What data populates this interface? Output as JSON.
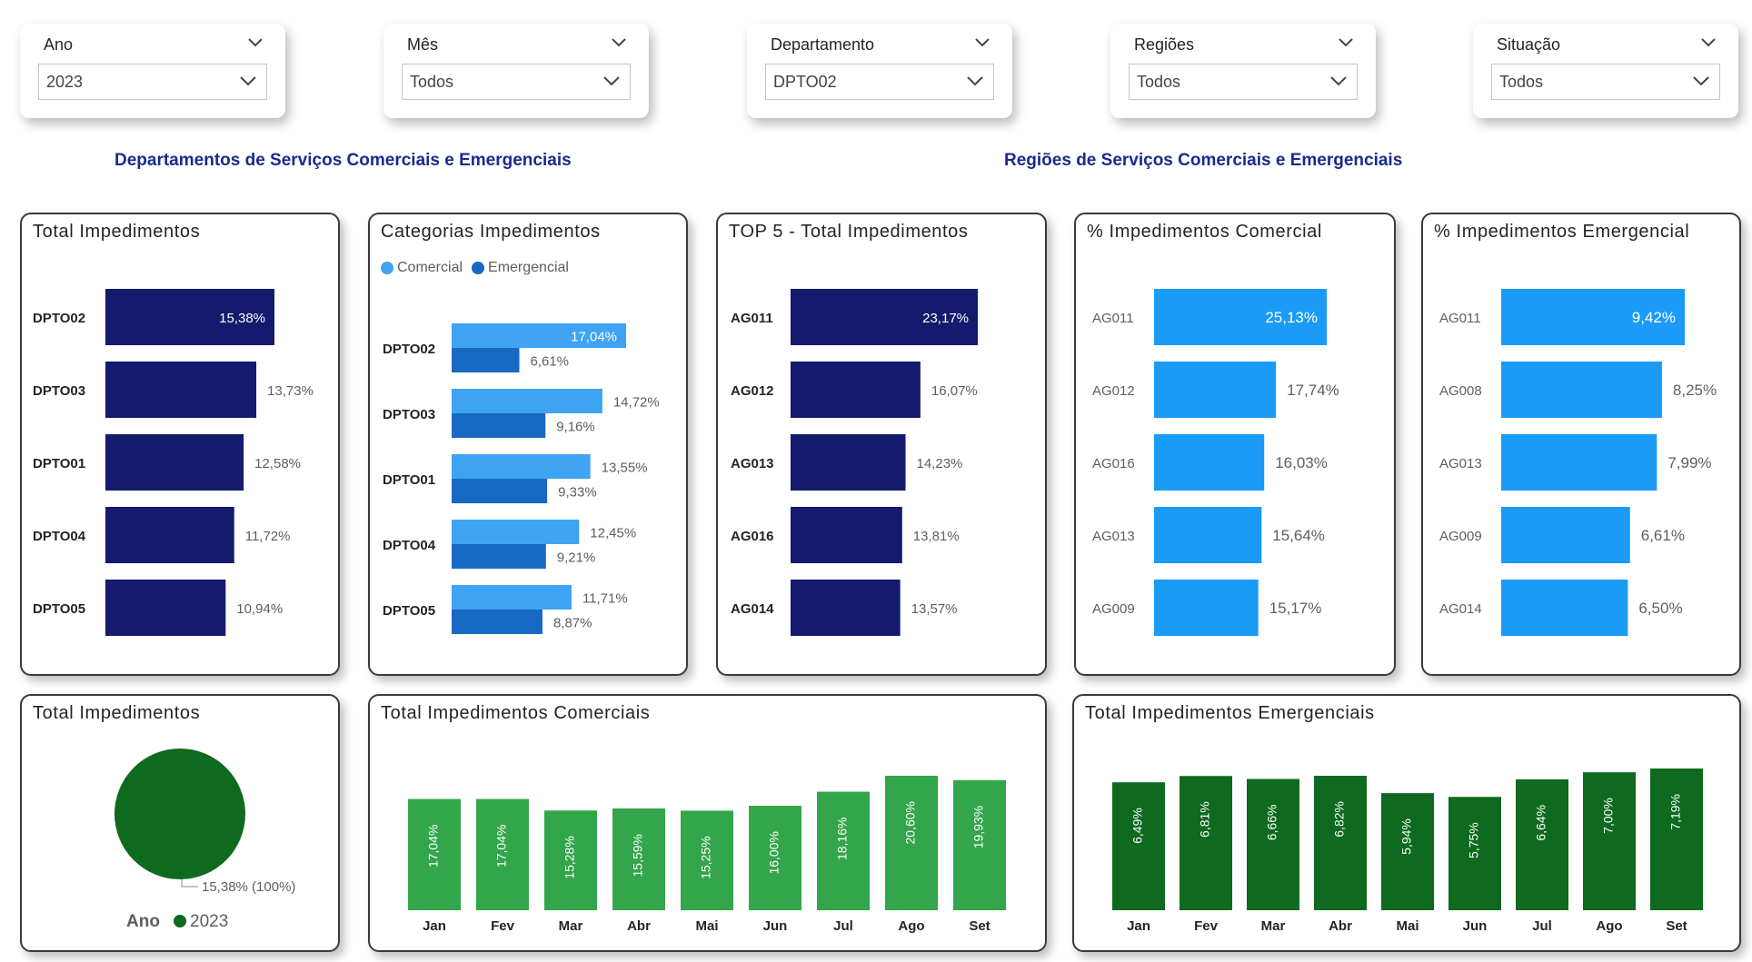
{
  "slicers": [
    {
      "label": "Ano",
      "value": "2023"
    },
    {
      "label": "Mês",
      "value": "Todos"
    },
    {
      "label": "Departamento",
      "value": "DPTO02"
    },
    {
      "label": "Regiões",
      "value": "Todos"
    },
    {
      "label": "Situação",
      "value": "Todos"
    }
  ],
  "section_titles": {
    "departments": "Departamentos de Serviços Comerciais e Emergenciais",
    "regions": "Regiões de Serviços Comerciais e Emergenciais"
  },
  "colors": {
    "dark_navy": "#141a6e",
    "light_blue": "#3fa3f3",
    "mid_blue": "#1769c4",
    "bright_blue": "#1a9bf5",
    "green_light": "#33a54a",
    "green_dark": "#0e6a1e",
    "title_blue": "#1b2a8c"
  },
  "chart_data": [
    {
      "type": "bar",
      "orientation": "horizontal",
      "title": "Total Impedimentos",
      "categories": [
        "DPTO02",
        "DPTO03",
        "DPTO01",
        "DPTO04",
        "DPTO05"
      ],
      "values": [
        15.38,
        13.73,
        12.58,
        11.72,
        10.94
      ],
      "labels": [
        "15,38%",
        "13,73%",
        "12,58%",
        "11,72%",
        "10,94%"
      ]
    },
    {
      "type": "bar",
      "orientation": "horizontal",
      "title": "Categorias Impedimentos",
      "legend": "top-left",
      "categories": [
        "DPTO02",
        "DPTO03",
        "DPTO01",
        "DPTO04",
        "DPTO05"
      ],
      "series": [
        {
          "name": "Comercial",
          "values": [
            17.04,
            14.72,
            13.55,
            12.45,
            11.71
          ],
          "labels": [
            "17,04%",
            "14,72%",
            "13,55%",
            "12,45%",
            "11,71%"
          ]
        },
        {
          "name": "Emergencial",
          "values": [
            6.61,
            9.16,
            9.33,
            9.21,
            8.87
          ],
          "labels": [
            "6,61%",
            "9,16%",
            "9,33%",
            "9,21%",
            "8,87%"
          ]
        }
      ]
    },
    {
      "type": "bar",
      "orientation": "horizontal",
      "title": "TOP 5 - Total Impedimentos",
      "categories": [
        "AG011",
        "AG012",
        "AG013",
        "AG016",
        "AG014"
      ],
      "values": [
        23.17,
        16.07,
        14.23,
        13.81,
        13.57
      ],
      "labels": [
        "23,17%",
        "16,07%",
        "14,23%",
        "13,81%",
        "13,57%"
      ]
    },
    {
      "type": "bar",
      "orientation": "horizontal",
      "title": "% Impedimentos Comercial",
      "categories": [
        "AG011",
        "AG012",
        "AG016",
        "AG013",
        "AG009"
      ],
      "values": [
        25.13,
        17.74,
        16.03,
        15.64,
        15.17
      ],
      "labels": [
        "25,13%",
        "17,74%",
        "16,03%",
        "15,64%",
        "15,17%"
      ]
    },
    {
      "type": "bar",
      "orientation": "horizontal",
      "title": "% Impedimentos Emergencial",
      "categories": [
        "AG011",
        "AG008",
        "AG013",
        "AG009",
        "AG014"
      ],
      "values": [
        9.42,
        8.25,
        7.99,
        6.61,
        6.5
      ],
      "labels": [
        "9,42%",
        "8,25%",
        "7,99%",
        "6,61%",
        "6,50%"
      ]
    },
    {
      "type": "pie",
      "title": "Total Impedimentos",
      "slices": [
        {
          "name": "2023",
          "value": 15.38,
          "label": "15,38% (100%)"
        }
      ],
      "legend_title": "Ano",
      "legend": "bottom"
    },
    {
      "type": "bar",
      "orientation": "vertical",
      "title": "Total Impedimentos Comerciais",
      "categories": [
        "Jan",
        "Fev",
        "Mar",
        "Abr",
        "Mai",
        "Jun",
        "Jul",
        "Ago",
        "Set"
      ],
      "values": [
        17.04,
        17.04,
        15.28,
        15.59,
        15.25,
        16.0,
        18.16,
        20.6,
        19.93
      ],
      "labels": [
        "17,04%",
        "17,04%",
        "15,28%",
        "15,59%",
        "15,25%",
        "16,00%",
        "18,16%",
        "20,60%",
        "19,93%"
      ]
    },
    {
      "type": "bar",
      "orientation": "vertical",
      "title": "Total Impedimentos Emergenciais",
      "categories": [
        "Jan",
        "Fev",
        "Mar",
        "Abr",
        "Mai",
        "Jun",
        "Jul",
        "Ago",
        "Set"
      ],
      "values": [
        6.49,
        6.81,
        6.66,
        6.82,
        5.94,
        5.75,
        6.64,
        7.0,
        7.19
      ],
      "labels": [
        "6,49%",
        "6,81%",
        "6,66%",
        "6,82%",
        "5,94%",
        "5,75%",
        "6,64%",
        "7,00%",
        "7,19%"
      ]
    }
  ]
}
